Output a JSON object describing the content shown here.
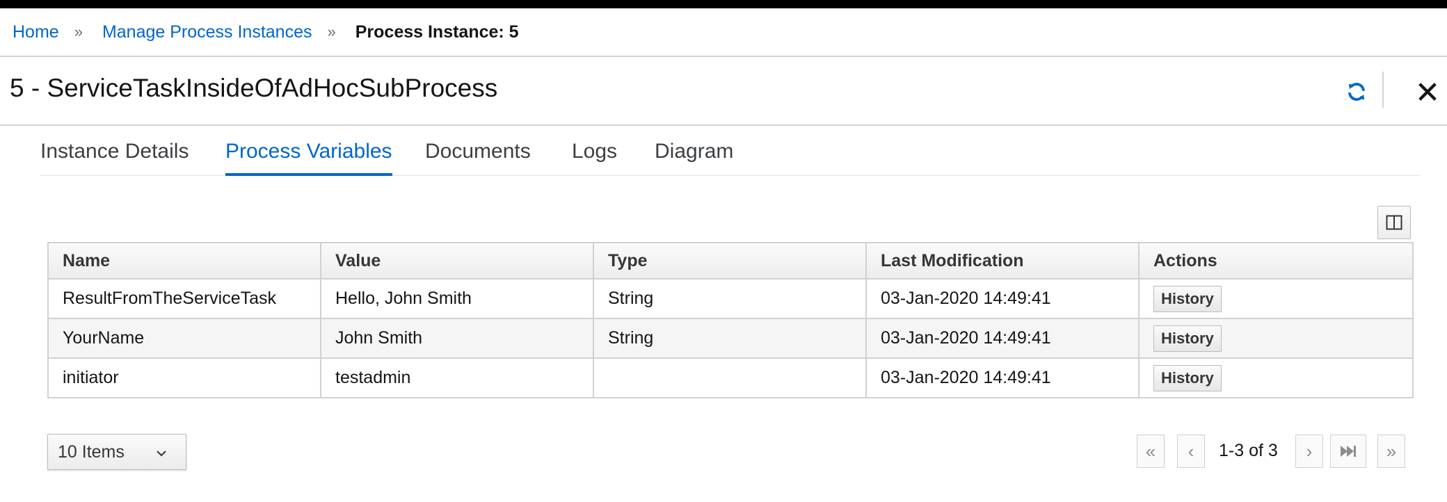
{
  "breadcrumb": {
    "items": [
      "Home",
      "Manage Process Instances"
    ],
    "separator": "»",
    "current": "Process Instance: 5"
  },
  "page": {
    "title": "5 - ServiceTaskInsideOfAdHocSubProcess"
  },
  "tabs": [
    {
      "label": "Instance Details",
      "active": false
    },
    {
      "label": "Process Variables",
      "active": true
    },
    {
      "label": "Documents",
      "active": false
    },
    {
      "label": "Logs",
      "active": false
    },
    {
      "label": "Diagram",
      "active": false
    }
  ],
  "table": {
    "columns": [
      "Name",
      "Value",
      "Type",
      "Last Modification",
      "Actions"
    ],
    "rows": [
      {
        "name": "ResultFromTheServiceTask",
        "value": "Hello, John Smith",
        "type": "String",
        "modified": "03-Jan-2020 14:49:41",
        "action": "History"
      },
      {
        "name": "YourName",
        "value": "John Smith",
        "type": "String",
        "modified": "03-Jan-2020 14:49:41",
        "action": "History"
      },
      {
        "name": "initiator",
        "value": "testadmin",
        "type": "",
        "modified": "03-Jan-2020 14:49:41",
        "action": "History"
      }
    ]
  },
  "pagination": {
    "page_size_label": "10 Items",
    "range_label": "1-3 of 3",
    "first_glyph": "«",
    "prev_glyph": "‹",
    "next_glyph": "›",
    "last_glyph": "»"
  },
  "icons": {
    "refresh": "refresh-icon",
    "close": "close-icon",
    "columns": "columns-icon",
    "chevron": "chevron-down-icon"
  },
  "colors": {
    "link": "#0066cc",
    "active_tab": "#0066cc",
    "text": "#151515",
    "border": "#d1d1d1"
  }
}
